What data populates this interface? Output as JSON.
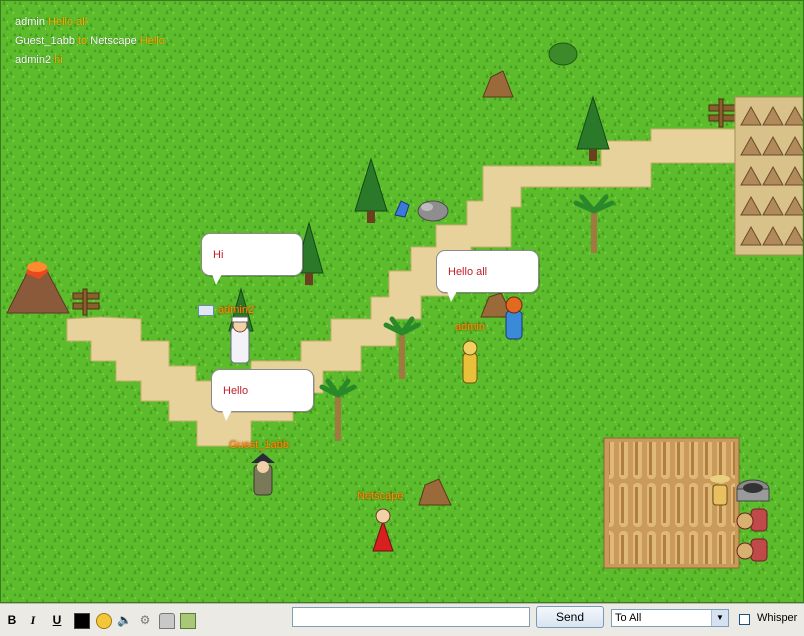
{
  "chat_log": [
    {
      "from": "admin",
      "to": "",
      "to_sep": "",
      "message": "Hello all"
    },
    {
      "from": "Guest_1abb",
      "to": "Netscape",
      "to_sep": "to",
      "message": "Hello"
    },
    {
      "from": "admin2",
      "to": "",
      "to_sep": "",
      "message": "hi"
    }
  ],
  "bubbles": {
    "admin2": "Hi",
    "admin": "Hello all",
    "guest": "Hello"
  },
  "players": {
    "admin2": "admin2",
    "admin": "admin",
    "guest": "Guest_1abb",
    "netscape": "Netscape"
  },
  "toolbar": {
    "bold": "B",
    "italic": "I",
    "underline": "U",
    "send_label": "Send",
    "target_value": "To All",
    "whisper_label": "Whisper"
  },
  "colors": {
    "grass": "#5fbf2f",
    "path": "#e8d49a",
    "name_text": "#ff8c00",
    "bubble_text": "#c0202a"
  }
}
